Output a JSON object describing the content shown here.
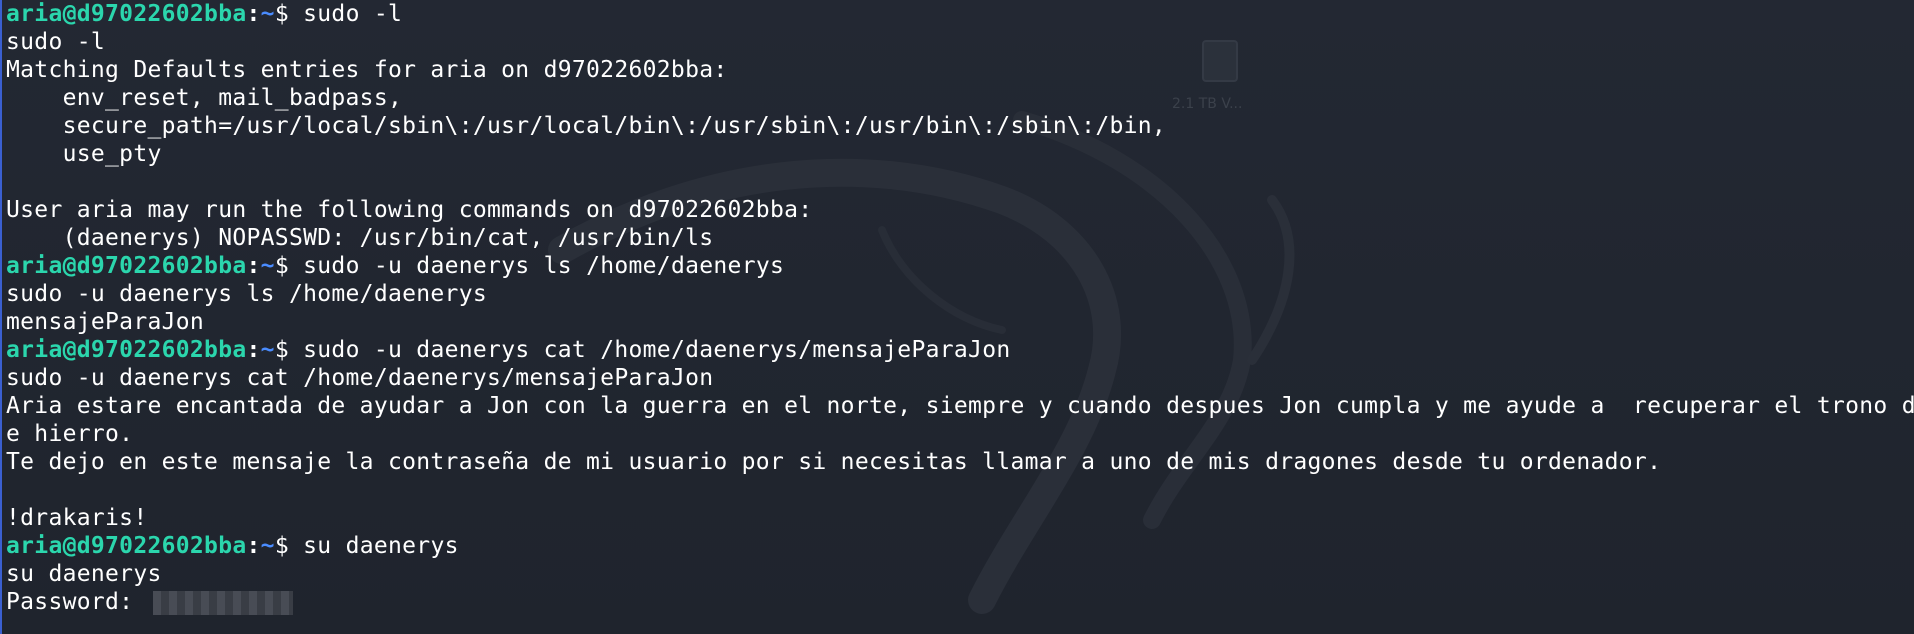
{
  "prompt": {
    "user": "aria@d97022602bba",
    "colon": ":",
    "path": "~",
    "dollar": "$"
  },
  "desktop": {
    "icon": "usb-drive-icon",
    "icon_label": "2.1 TB V..."
  },
  "lines": [
    {
      "type": "prompt",
      "cmd": " sudo -l"
    },
    {
      "type": "text",
      "text": "sudo -l"
    },
    {
      "type": "text",
      "text": "Matching Defaults entries for aria on d97022602bba:"
    },
    {
      "type": "text",
      "text": "    env_reset, mail_badpass,"
    },
    {
      "type": "text",
      "text": "    secure_path=/usr/local/sbin\\:/usr/local/bin\\:/usr/sbin\\:/usr/bin\\:/sbin\\:/bin,"
    },
    {
      "type": "text",
      "text": "    use_pty"
    },
    {
      "type": "text",
      "text": ""
    },
    {
      "type": "text",
      "text": "User aria may run the following commands on d97022602bba:"
    },
    {
      "type": "text",
      "text": "    (daenerys) NOPASSWD: /usr/bin/cat, /usr/bin/ls"
    },
    {
      "type": "prompt",
      "cmd": " sudo -u daenerys ls /home/daenerys"
    },
    {
      "type": "text",
      "text": "sudo -u daenerys ls /home/daenerys"
    },
    {
      "type": "text",
      "text": "mensajeParaJon"
    },
    {
      "type": "prompt",
      "cmd": " sudo -u daenerys cat /home/daenerys/mensajeParaJon"
    },
    {
      "type": "text",
      "text": "sudo -u daenerys cat /home/daenerys/mensajeParaJon"
    },
    {
      "type": "text",
      "text": "Aria estare encantada de ayudar a Jon con la guerra en el norte, siempre y cuando despues Jon cumpla y me ayude a  recuperar el trono d"
    },
    {
      "type": "text",
      "text": "e hierro."
    },
    {
      "type": "text",
      "text": "Te dejo en este mensaje la contraseña de mi usuario por si necesitas llamar a uno de mis dragones desde tu ordenador."
    },
    {
      "type": "text",
      "text": ""
    },
    {
      "type": "text",
      "text": "!drakaris!"
    },
    {
      "type": "prompt",
      "cmd": " su daenerys"
    },
    {
      "type": "text",
      "text": "su daenerys"
    },
    {
      "type": "password",
      "text": "Password: "
    }
  ],
  "colors": {
    "background": "#20252e",
    "user": "#2bd6ad",
    "path": "#4a8cff",
    "text": "#ffffff"
  }
}
